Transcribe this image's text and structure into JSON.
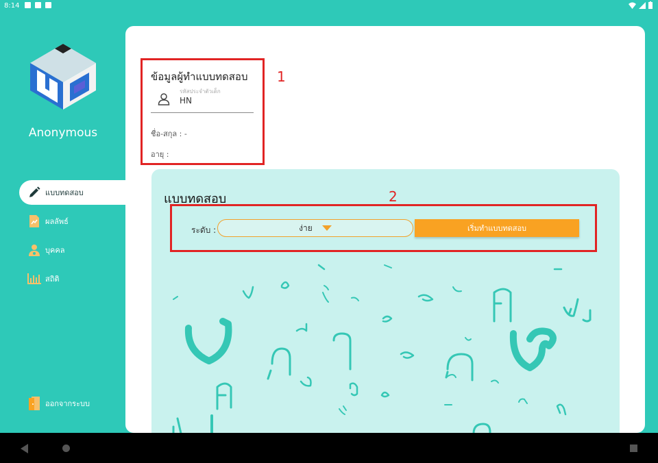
{
  "status_bar": {
    "time": "8:14"
  },
  "sidebar": {
    "brand": "Anonymous",
    "items": [
      {
        "label": "แบบทดสอบ",
        "icon": "pencil-icon",
        "active": true
      },
      {
        "label": "ผลลัพธ์",
        "icon": "document-icon",
        "active": false
      },
      {
        "label": "บุคคล",
        "icon": "person-icon",
        "active": false
      },
      {
        "label": "สถิติ",
        "icon": "bar-chart-icon",
        "active": false
      }
    ],
    "logout_label": "ออกจากระบบ"
  },
  "tester_info": {
    "title": "ข้อมูลผู้ทำแบบทดสอบ",
    "hn_label": "รหัสประจำตัวเด็ก",
    "hn_placeholder": "HN",
    "name_label": "ชื่อ-สกุล : -",
    "age_label": "อายุ :"
  },
  "quiz": {
    "title": "แบบทดสอบ",
    "level_label": "ระดับ :",
    "level_value": "ง่าย",
    "start_button": "เริ่มทำแบบทดสอบ"
  },
  "annotations": [
    "1",
    "2"
  ],
  "colors": {
    "teal": "#2ec9b8",
    "light_teal": "#c9f2ee",
    "orange": "#f9a222",
    "red": "#e12424"
  }
}
